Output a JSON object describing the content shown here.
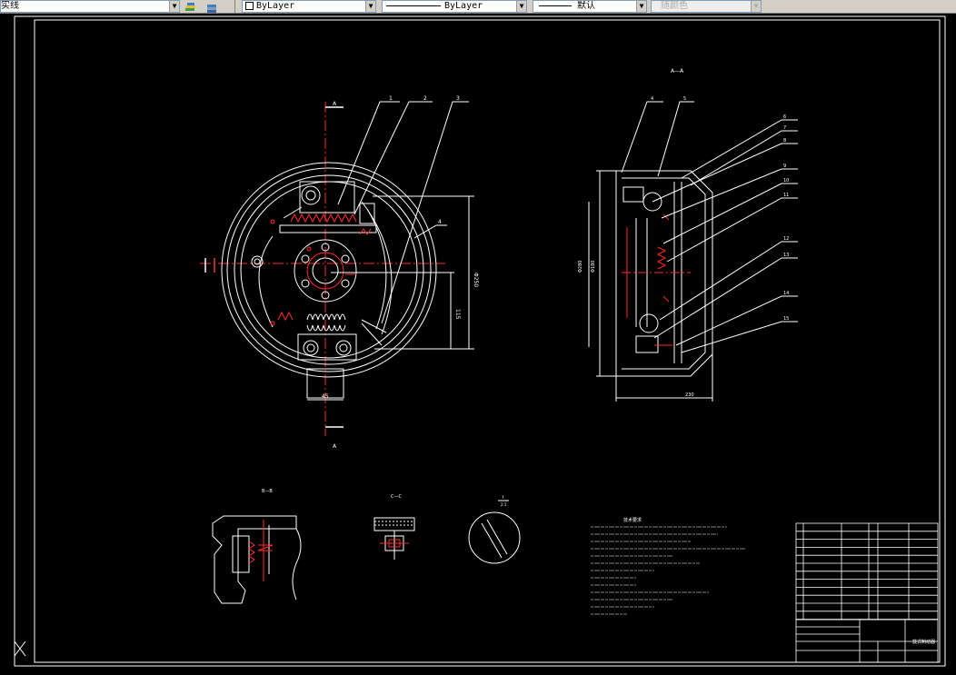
{
  "toolbar": {
    "layer_name": "实线",
    "color": "ByLayer",
    "linetype": "ByLayer",
    "lineweight": "默认",
    "plotstyle": "随颜色",
    "icons": [
      "layer-states-icon",
      "layer-previous-icon"
    ]
  },
  "drawing": {
    "view_aa_title": "A—A",
    "view_bb_title": "B—B",
    "view_cc_title": "C—C",
    "section_mark": "A",
    "leader_numbers_front": [
      "1",
      "2",
      "3",
      "4"
    ],
    "leader_numbers_side": [
      "4",
      "5",
      "6",
      "7",
      "8",
      "9",
      "10",
      "11",
      "12",
      "13",
      "14",
      "15"
    ],
    "dims": {
      "d1": "Φ250",
      "d2": "115",
      "d3": "45",
      "d4": "230",
      "d5": "58"
    },
    "notes_title": "技术要求"
  },
  "title_block": {
    "drawing_name": "鼓式制动器"
  },
  "colors": {
    "background": "#000000",
    "line_white": "#ffffff",
    "line_red": "#ff2a2a",
    "toolbar": "#d4d0c8"
  }
}
